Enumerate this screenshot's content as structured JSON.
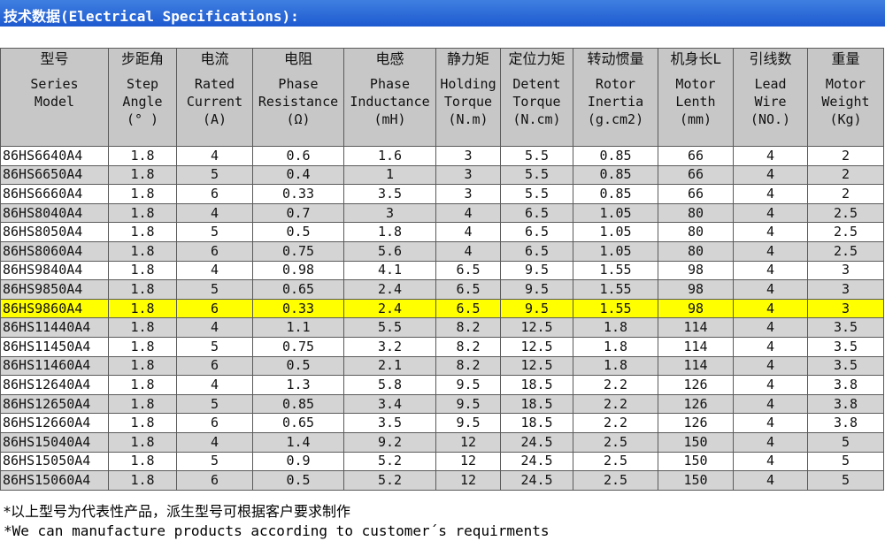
{
  "title": "技术数据(Electrical Specifications):",
  "columns": [
    {
      "zh": "型号",
      "en": "Series\nModel"
    },
    {
      "zh": "步距角",
      "en": "Step\nAngle\n(° )"
    },
    {
      "zh": "电流",
      "en": "Rated\nCurrent\n(A)"
    },
    {
      "zh": "电阻",
      "en": "Phase\nResistance\n(Ω)"
    },
    {
      "zh": "电感",
      "en": "Phase\nInductance\n(mH)"
    },
    {
      "zh": "静力矩",
      "en": "Holding\nTorque\n(N.m)"
    },
    {
      "zh": "定位力矩",
      "en": "Detent\nTorque\n(N.cm)"
    },
    {
      "zh": "转动惯量",
      "en": "Rotor\nInertia\n(g.cm2)"
    },
    {
      "zh": "机身长L",
      "en": "Motor\nLenth\n(mm)"
    },
    {
      "zh": "引线数",
      "en": "Lead\nWire\n(NO.)"
    },
    {
      "zh": "重量",
      "en": "Motor\nWeight\n(Kg)"
    }
  ],
  "rows": [
    [
      "86HS6640A4",
      "1.8",
      "4",
      "0.6",
      "1.6",
      "3",
      "5.5",
      "0.85",
      "66",
      "4",
      "2"
    ],
    [
      "86HS6650A4",
      "1.8",
      "5",
      "0.4",
      "1",
      "3",
      "5.5",
      "0.85",
      "66",
      "4",
      "2"
    ],
    [
      "86HS6660A4",
      "1.8",
      "6",
      "0.33",
      "3.5",
      "3",
      "5.5",
      "0.85",
      "66",
      "4",
      "2"
    ],
    [
      "86HS8040A4",
      "1.8",
      "4",
      "0.7",
      "3",
      "4",
      "6.5",
      "1.05",
      "80",
      "4",
      "2.5"
    ],
    [
      "86HS8050A4",
      "1.8",
      "5",
      "0.5",
      "1.8",
      "4",
      "6.5",
      "1.05",
      "80",
      "4",
      "2.5"
    ],
    [
      "86HS8060A4",
      "1.8",
      "6",
      "0.75",
      "5.6",
      "4",
      "6.5",
      "1.05",
      "80",
      "4",
      "2.5"
    ],
    [
      "86HS9840A4",
      "1.8",
      "4",
      "0.98",
      "4.1",
      "6.5",
      "9.5",
      "1.55",
      "98",
      "4",
      "3"
    ],
    [
      "86HS9850A4",
      "1.8",
      "5",
      "0.65",
      "2.4",
      "6.5",
      "9.5",
      "1.55",
      "98",
      "4",
      "3"
    ],
    [
      "86HS9860A4",
      "1.8",
      "6",
      "0.33",
      "2.4",
      "6.5",
      "9.5",
      "1.55",
      "98",
      "4",
      "3"
    ],
    [
      "86HS11440A4",
      "1.8",
      "4",
      "1.1",
      "5.5",
      "8.2",
      "12.5",
      "1.8",
      "114",
      "4",
      "3.5"
    ],
    [
      "86HS11450A4",
      "1.8",
      "5",
      "0.75",
      "3.2",
      "8.2",
      "12.5",
      "1.8",
      "114",
      "4",
      "3.5"
    ],
    [
      "86HS11460A4",
      "1.8",
      "6",
      "0.5",
      "2.1",
      "8.2",
      "12.5",
      "1.8",
      "114",
      "4",
      "3.5"
    ],
    [
      "86HS12640A4",
      "1.8",
      "4",
      "1.3",
      "5.8",
      "9.5",
      "18.5",
      "2.2",
      "126",
      "4",
      "3.8"
    ],
    [
      "86HS12650A4",
      "1.8",
      "5",
      "0.85",
      "3.4",
      "9.5",
      "18.5",
      "2.2",
      "126",
      "4",
      "3.8"
    ],
    [
      "86HS12660A4",
      "1.8",
      "6",
      "0.65",
      "3.5",
      "9.5",
      "18.5",
      "2.2",
      "126",
      "4",
      "3.8"
    ],
    [
      "86HS15040A4",
      "1.8",
      "4",
      "1.4",
      "9.2",
      "12",
      "24.5",
      "2.5",
      "150",
      "4",
      "5"
    ],
    [
      "86HS15050A4",
      "1.8",
      "5",
      "0.9",
      "5.2",
      "12",
      "24.5",
      "2.5",
      "150",
      "4",
      "5"
    ],
    [
      "86HS15060A4",
      "1.8",
      "6",
      "0.5",
      "5.2",
      "12",
      "24.5",
      "2.5",
      "150",
      "4",
      "5"
    ]
  ],
  "highlighted_model": "86HS9860A4",
  "highlight_color": "#ffff00",
  "header_color": "#c7c7c7",
  "title_bar_color": "#2a66d8",
  "note_zh": "*以上型号为代表性产品，派生型号可根据客户要求制作",
  "note_en": "*We can manufacture products according to customer´s requirments"
}
